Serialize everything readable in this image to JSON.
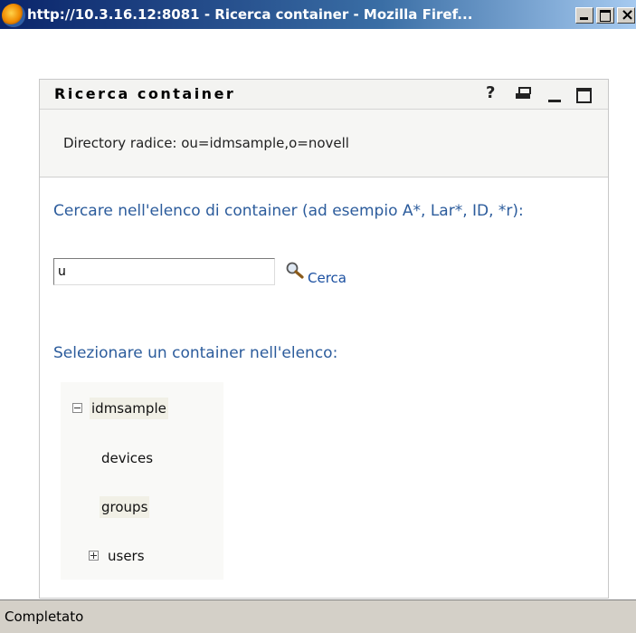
{
  "window": {
    "title": "http://10.3.16.12:8081 - Ricerca container - Mozilla Firef...",
    "controls": [
      "minimize",
      "maximize",
      "close"
    ]
  },
  "portlet": {
    "title": "Ricerca container",
    "help_label": "?",
    "root_directory": "Directory radice: ou=idmsample,o=novell"
  },
  "search": {
    "prompt": "Cercare nell'elenco di container (ad esempio A*, Lar*, ID, *r):",
    "value": "u",
    "button_label": "Cerca"
  },
  "tree": {
    "label": "Selezionare un container nell'elenco:",
    "root": {
      "label": "idmsample",
      "expanded": true
    },
    "children": [
      {
        "label": "devices",
        "expandable": false
      },
      {
        "label": "groups",
        "expandable": false
      },
      {
        "label": "users",
        "expandable": true,
        "expanded": false
      }
    ]
  },
  "status": {
    "text": "Completato"
  },
  "colors": {
    "link": "#1a4fa0",
    "label": "#2c5c9c",
    "titlebar": "#0a246a"
  }
}
